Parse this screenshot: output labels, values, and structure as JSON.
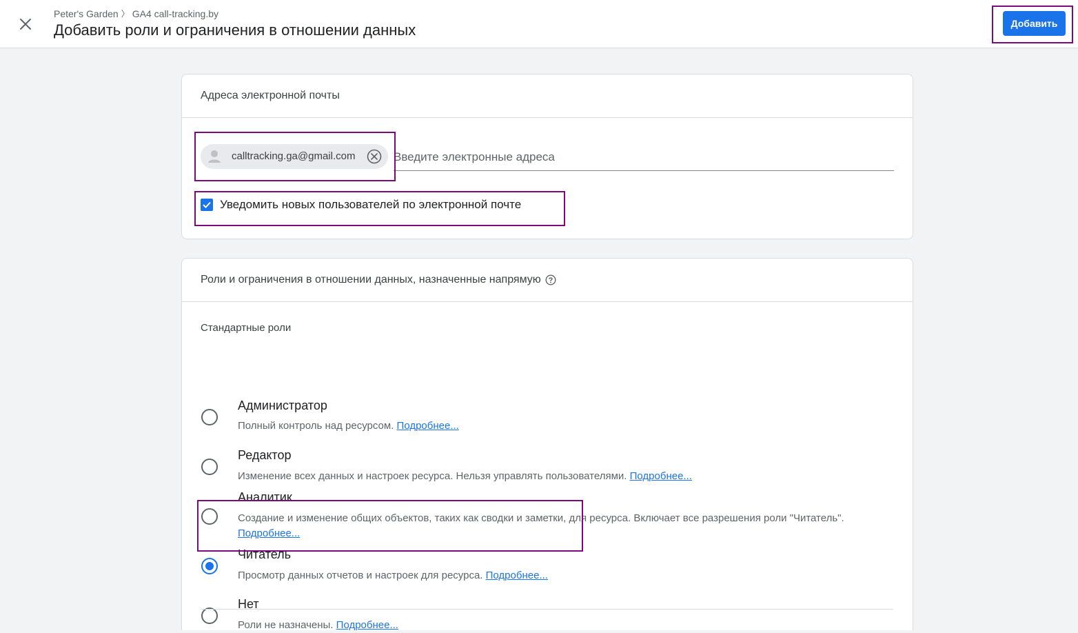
{
  "header": {
    "breadcrumb": [
      "Peter's Garden",
      "GA4 call-tracking.by"
    ],
    "breadcrumb_separator": "〉",
    "title": "Добавить роли и ограничения в отношении данных",
    "add_button": "Добавить",
    "close_icon": "close-icon"
  },
  "email_section": {
    "title": "Адреса электронной почты",
    "chip": {
      "email": "calltracking.ga@gmail.com",
      "avatar_icon": "person-icon",
      "remove_icon": "remove-circle-icon"
    },
    "input_placeholder": "Введите электронные адреса",
    "notify": {
      "label": "Уведомить новых пользователей по электронной почте",
      "checked": true
    }
  },
  "roles_section": {
    "title": "Роли и ограничения в отношении данных, назначенные напрямую",
    "help_icon": "help-circle-icon",
    "standard_roles_label": "Стандартные роли",
    "roles": [
      {
        "title": "Администратор",
        "description": "Полный контроль над ресурсом.",
        "link": "Подробнее...",
        "selected": false
      },
      {
        "title": "Редактор",
        "description": "Изменение всех данных и настроек ресурса. Нельзя управлять пользователями.",
        "link": "Подробнее...",
        "selected": false
      },
      {
        "title": "Аналитик",
        "description": "Создание и изменение общих объектов, таких как сводки и заметки, для ресурса. Включает все разрешения роли \"Читатель\".",
        "link": "Подробнее...",
        "selected": false
      },
      {
        "title": "Читатель",
        "description": "Просмотр данных отчетов и настроек для ресурса.",
        "link": "Подробнее...",
        "selected": true
      },
      {
        "title": "Нет",
        "description": "Роли не назначены.",
        "link": "Подробнее...",
        "selected": false
      }
    ]
  },
  "colors": {
    "accent": "#1a73e8",
    "highlight": "#7b0b7c"
  }
}
